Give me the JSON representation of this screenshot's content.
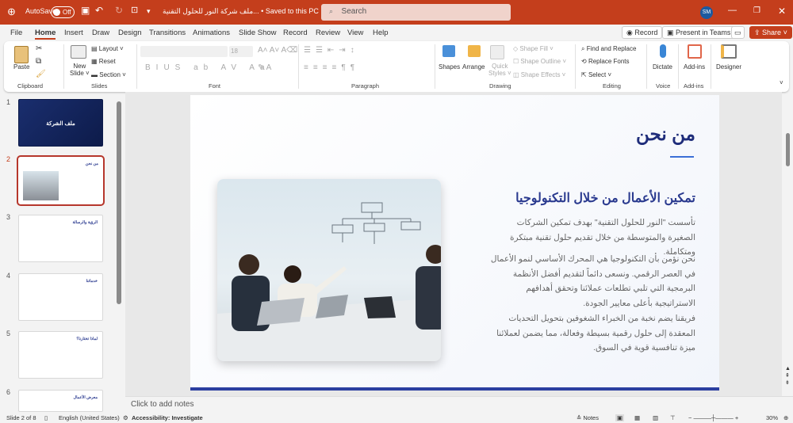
{
  "titlebar": {
    "autosave": "AutoSave",
    "toggle": "Off",
    "doc_title": "ملف شركة النور للحلول التقنية... • Saved to this PC ⌄",
    "search": "Search",
    "avatar": "SM"
  },
  "menu": [
    "File",
    "Home",
    "Insert",
    "Draw",
    "Design",
    "Transitions",
    "Animations",
    "Slide Show",
    "Record",
    "Review",
    "View",
    "Help"
  ],
  "actions": {
    "record": "Record",
    "present": "Present in Teams",
    "share": "Share"
  },
  "ribbon": {
    "clipboard": {
      "paste": "Paste",
      "label": "Clipboard"
    },
    "slides": {
      "new_slide": "New",
      "new_slide2": "Slide ˅",
      "layout": "Layout ˅",
      "reset": "Reset",
      "section": "Section ˅",
      "label": "Slides"
    },
    "font": {
      "size": "18",
      "label": "Font"
    },
    "paragraph": {
      "label": "Paragraph"
    },
    "drawing": {
      "shapes": "Shapes",
      "arrange": "Arrange",
      "quick": "Quick",
      "quick2": "Styles ˅",
      "fill": "Shape Fill ˅",
      "outline": "Shape Outline ˅",
      "effects": "Shape Effects ˅",
      "label": "Drawing"
    },
    "editing": {
      "find": "Find and Replace",
      "replace": "Replace Fonts",
      "select": "Select ˅",
      "label": "Editing"
    },
    "voice": {
      "dictate": "Dictate",
      "label": "Voice"
    },
    "addins": {
      "addins": "Add-ins",
      "label": "Add-ins"
    },
    "designer": {
      "designer": "Designer"
    }
  },
  "thumbnails": [
    {
      "num": "1",
      "title": "ملف الشركة"
    },
    {
      "num": "2",
      "title": "من نحن"
    },
    {
      "num": "3",
      "title": "الرؤية والرسالة"
    },
    {
      "num": "4",
      "title": "خدماتنا"
    },
    {
      "num": "5",
      "title": "لماذا تختارنا؟"
    },
    {
      "num": "6",
      "title": "معرض الأعمال"
    }
  ],
  "slide": {
    "title": "من نحن",
    "heading": "تمكين الأعمال من خلال التكنولوجيا",
    "p1": "تأسست \"النور للحلول التقنية\" بهدف تمكين الشركات الصغيرة والمتوسطة من خلال تقديم حلول تقنية مبتكرة ومتكاملة.",
    "p2": "نحن نؤمن بأن التكنولوجيا هي المحرك الأساسي لنمو الأعمال في العصر الرقمي. ونسعى دائماً لتقديم أفضل الأنظمة البرمجية التي تلبي تطلعات عملائنا وتحقق أهدافهم الاستراتيجية بأعلى معايير الجودة.",
    "p3": "فريقنا يضم نخبة من الخبراء الشغوفين بتحويل التحديات المعقدة إلى حلول رقمية بسيطة وفعالة، مما يضمن لعملائنا ميزة تنافسية قوية في السوق."
  },
  "notes": "Click to add notes",
  "status": {
    "slide": "Slide 2 of 8",
    "lang": "English (United States)",
    "access": "Accessibility: Investigate",
    "notes": "Notes",
    "zoom": "30%"
  }
}
